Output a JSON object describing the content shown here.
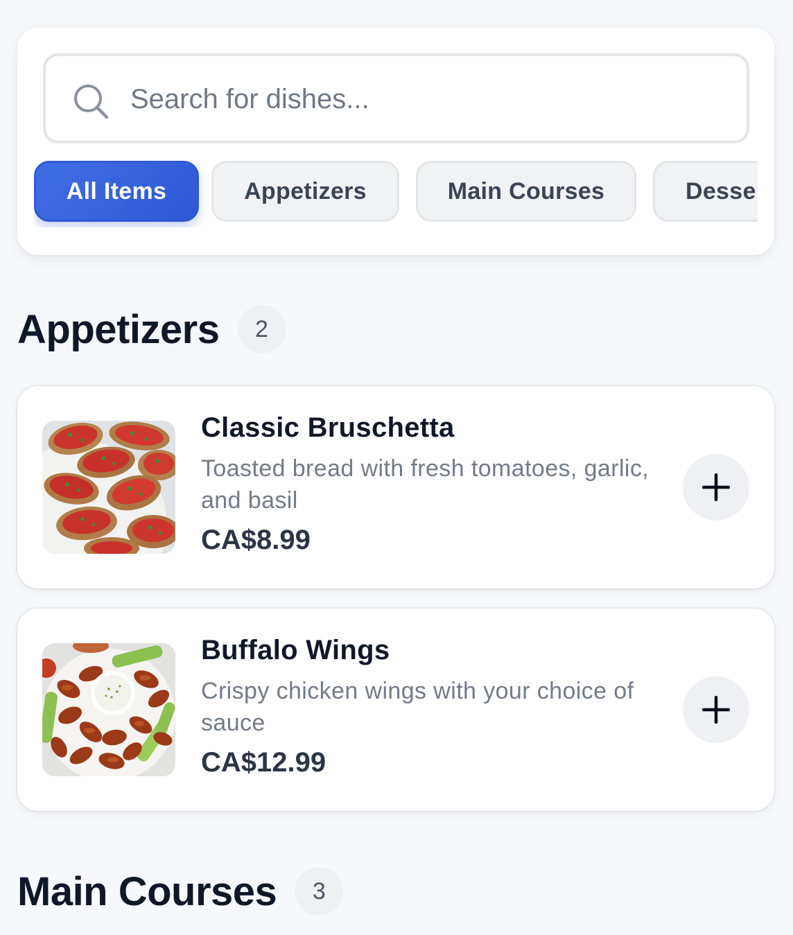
{
  "search": {
    "placeholder": "Search for dishes...",
    "icon": "search-icon"
  },
  "categories": [
    {
      "label": "All Items",
      "active": true
    },
    {
      "label": "Appetizers",
      "active": false
    },
    {
      "label": "Main Courses",
      "active": false
    },
    {
      "label": "Desserts",
      "active": false
    }
  ],
  "sections": [
    {
      "title": "Appetizers",
      "count": "2",
      "items": [
        {
          "name": "Classic Bruschetta",
          "description": "Toasted bread with fresh tomatoes, garlic, and basil",
          "price": "CA$8.99",
          "add_icon": "plus-icon"
        },
        {
          "name": "Buffalo Wings",
          "description": "Crispy chicken wings with your choice of sauce",
          "price": "CA$12.99",
          "add_icon": "plus-icon"
        }
      ]
    },
    {
      "title": "Main Courses",
      "count": "3",
      "items": []
    }
  ],
  "colors": {
    "accent": "#3060d8",
    "background": "#f7f8fb",
    "card": "#ffffff",
    "muted_text": "#737b87"
  }
}
